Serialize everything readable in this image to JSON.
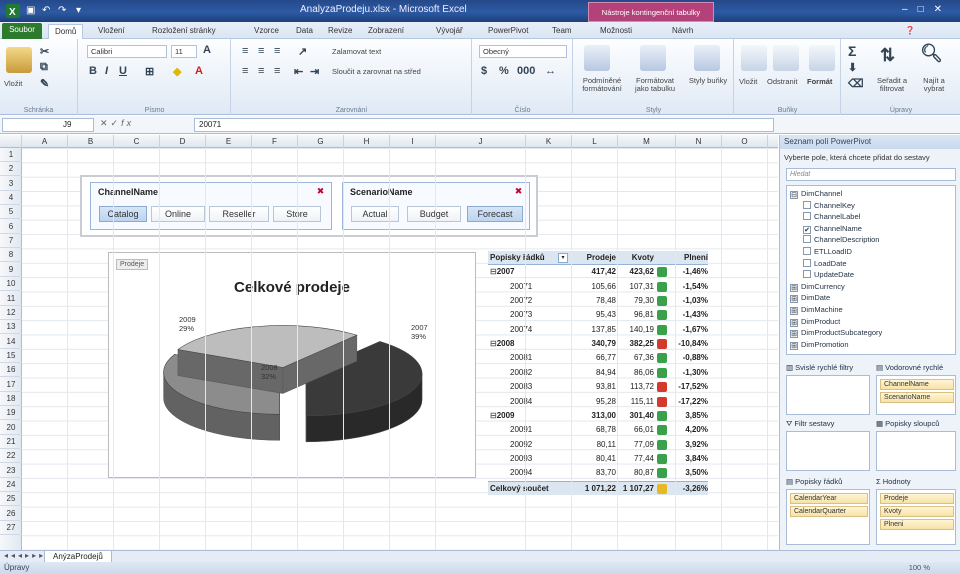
{
  "window": {
    "title": "AnalyzaProdeju.xlsx - Microsoft Excel",
    "context_tab": "Nástroje kontingenční tabulky"
  },
  "ribbon_tabs": [
    "Soubor",
    "Domů",
    "Vložení",
    "Rozložení stránky",
    "Vzorce",
    "Data",
    "Revize",
    "Zobrazení",
    "Vývojář",
    "PowerPivot",
    "Team",
    "Možnosti",
    "Návrh"
  ],
  "ribbon": {
    "clipboard": {
      "label": "Schránka",
      "paste": "Vložit"
    },
    "font": {
      "label": "Písmo",
      "name": "Calibri",
      "size": "11"
    },
    "alignment": {
      "label": "Zarovnání",
      "wrap": "Zalamovat text",
      "merge": "Sloučit a zarovnat na střed"
    },
    "number": {
      "label": "Číslo",
      "format": "Obecný"
    },
    "styles": {
      "label": "Styly",
      "conditional": "Podmíněné formátování",
      "table": "Formátovat jako tabulku",
      "cell": "Styly buňky"
    },
    "cells": {
      "label": "Buňky",
      "insert": "Vložit",
      "delete": "Odstranit",
      "format": "Formát"
    },
    "editing": {
      "label": "Úpravy",
      "sort": "Seřadit a filtrovat",
      "find": "Najít a vybrat"
    }
  },
  "formula_bar": {
    "cell_ref": "J9",
    "formula": "20071"
  },
  "columns": [
    "A",
    "B",
    "C",
    "D",
    "E",
    "F",
    "G",
    "H",
    "I",
    "J",
    "K",
    "L",
    "M",
    "N",
    "O"
  ],
  "rows": [
    "1",
    "2",
    "3",
    "4",
    "5",
    "6",
    "7",
    "8",
    "9",
    "10",
    "11",
    "12",
    "13",
    "14",
    "15",
    "16",
    "17",
    "18",
    "19",
    "20",
    "21",
    "22",
    "23",
    "24",
    "25",
    "26",
    "27"
  ],
  "slicers": [
    {
      "title": "ChannelName",
      "items": [
        "Catalog",
        "Online",
        "Reseller",
        "Store"
      ],
      "selected": "Catalog"
    },
    {
      "title": "ScenarioName",
      "items": [
        "Actual",
        "Budget",
        "Forecast"
      ],
      "selected": "Forecast"
    }
  ],
  "chart_data": {
    "type": "pie",
    "title": "Celkové prodeje",
    "tag": "Prodeje",
    "slices": [
      {
        "label": "2007",
        "percent": "39%",
        "value": 39,
        "color": "#3a3a3a"
      },
      {
        "label": "2008",
        "percent": "32%",
        "value": 32,
        "color": "#8c8c8c"
      },
      {
        "label": "2009",
        "percent": "29%",
        "value": 29,
        "color": "#bdbdbd"
      }
    ]
  },
  "pivot": {
    "headers": [
      "Popisky řádků",
      "Prodeje",
      "Kvoty",
      "Plnení"
    ],
    "rows": [
      {
        "label": "2007",
        "level": 0,
        "expander": "⊟",
        "prodeje": "417,42",
        "kvoty": "423,62",
        "flag": "green",
        "plneni": "-1,46%",
        "bold": true
      },
      {
        "label": "20071",
        "level": 1,
        "expander": "",
        "prodeje": "105,66",
        "kvoty": "107,31",
        "flag": "green",
        "plneni": "-1,54%",
        "bold": false
      },
      {
        "label": "20072",
        "level": 1,
        "expander": "",
        "prodeje": "78,48",
        "kvoty": "79,30",
        "flag": "green",
        "plneni": "-1,03%",
        "bold": false
      },
      {
        "label": "20073",
        "level": 1,
        "expander": "",
        "prodeje": "95,43",
        "kvoty": "96,81",
        "flag": "green",
        "plneni": "-1,43%",
        "bold": false
      },
      {
        "label": "20074",
        "level": 1,
        "expander": "",
        "prodeje": "137,85",
        "kvoty": "140,19",
        "flag": "green",
        "plneni": "-1,67%",
        "bold": false
      },
      {
        "label": "2008",
        "level": 0,
        "expander": "⊟",
        "prodeje": "340,79",
        "kvoty": "382,25",
        "flag": "red",
        "plneni": "-10,84%",
        "bold": true
      },
      {
        "label": "20081",
        "level": 1,
        "expander": "",
        "prodeje": "66,77",
        "kvoty": "67,36",
        "flag": "green",
        "plneni": "-0,88%",
        "bold": false
      },
      {
        "label": "20082",
        "level": 1,
        "expander": "",
        "prodeje": "84,94",
        "kvoty": "86,06",
        "flag": "green",
        "plneni": "-1,30%",
        "bold": false
      },
      {
        "label": "20083",
        "level": 1,
        "expander": "",
        "prodeje": "93,81",
        "kvoty": "113,72",
        "flag": "red",
        "plneni": "-17,52%",
        "bold": false
      },
      {
        "label": "20084",
        "level": 1,
        "expander": "",
        "prodeje": "95,28",
        "kvoty": "115,11",
        "flag": "red",
        "plneni": "-17,22%",
        "bold": false
      },
      {
        "label": "2009",
        "level": 0,
        "expander": "⊟",
        "prodeje": "313,00",
        "kvoty": "301,40",
        "flag": "green",
        "plneni": "3,85%",
        "bold": true
      },
      {
        "label": "20091",
        "level": 1,
        "expander": "",
        "prodeje": "68,78",
        "kvoty": "66,01",
        "flag": "green",
        "plneni": "4,20%",
        "bold": false
      },
      {
        "label": "20092",
        "level": 1,
        "expander": "",
        "prodeje": "80,11",
        "kvoty": "77,09",
        "flag": "green",
        "plneni": "3,92%",
        "bold": false
      },
      {
        "label": "20093",
        "level": 1,
        "expander": "",
        "prodeje": "80,41",
        "kvoty": "77,44",
        "flag": "green",
        "plneni": "3,84%",
        "bold": false
      },
      {
        "label": "20094",
        "level": 1,
        "expander": "",
        "prodeje": "83,70",
        "kvoty": "80,87",
        "flag": "green",
        "plneni": "3,50%",
        "bold": false
      },
      {
        "label": "Celkový součet",
        "level": 0,
        "expander": "",
        "prodeje": "1 071,22",
        "kvoty": "1 107,27",
        "flag": "yellow",
        "plneni": "-3,26%",
        "bold": true
      }
    ]
  },
  "task_pane": {
    "title": "Seznam polí PowerPivot",
    "prompt": "Vyberte pole, která chcete přidat do sestavy",
    "search_placeholder": "Hledat",
    "fields": [
      {
        "label": "DimChannel",
        "type": "table",
        "expander": "⊟"
      },
      {
        "label": "ChannelKey",
        "type": "field",
        "checked": false
      },
      {
        "label": "ChannelLabel",
        "type": "field",
        "checked": false
      },
      {
        "label": "ChannelName",
        "type": "field",
        "checked": true
      },
      {
        "label": "ChannelDescription",
        "type": "field",
        "checked": false
      },
      {
        "label": "ETLLoadID",
        "type": "field",
        "checked": false
      },
      {
        "label": "LoadDate",
        "type": "field",
        "checked": false
      },
      {
        "label": "UpdateDate",
        "type": "field",
        "checked": false
      },
      {
        "label": "DimCurrency",
        "type": "table",
        "expander": "⊞"
      },
      {
        "label": "DimDate",
        "type": "table",
        "expander": "⊞"
      },
      {
        "label": "DimMachine",
        "type": "table",
        "expander": "⊞"
      },
      {
        "label": "DimProduct",
        "type": "table",
        "expander": "⊞"
      },
      {
        "label": "DimProductSubcategory",
        "type": "table",
        "expander": "⊞"
      },
      {
        "label": "DimPromotion",
        "type": "table",
        "expander": "⊞"
      }
    ],
    "zones": {
      "vertical_slicers": "Svislé rychlé filtry",
      "horizontal_slicers": "Vodorovné rychlé",
      "horizontal_items": [
        "ChannelName",
        "ScenarioName"
      ],
      "report_filter": "Filtr sestavy",
      "column_labels": "Popisky sloupců",
      "row_labels": "Popisky řádků",
      "row_items": [
        "CalendarYear",
        "CalendarQuarter"
      ],
      "values": "Hodnoty",
      "value_items": [
        "Prodeje",
        "Kvoty",
        "Plneni"
      ]
    }
  },
  "sheet_tab": "AnýzaProdejů",
  "status": {
    "text": "Úpravy",
    "zoom": "100 %"
  }
}
